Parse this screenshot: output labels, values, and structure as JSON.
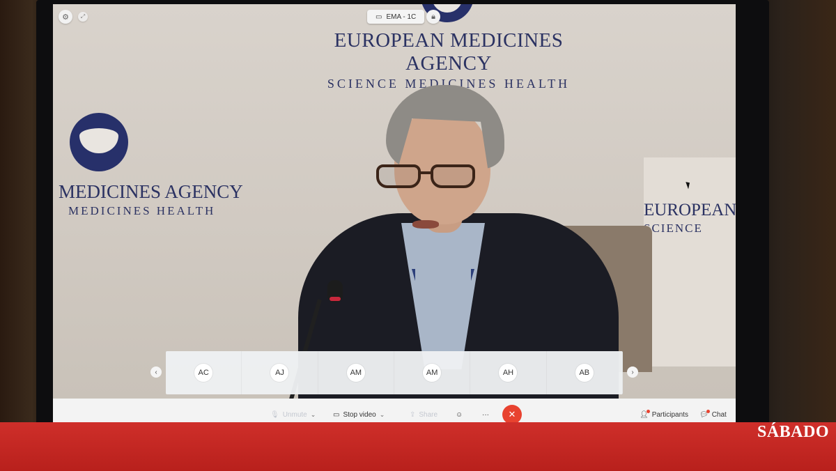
{
  "meeting": {
    "title": "EMA - 1C"
  },
  "backdrop": {
    "org_name": "EUROPEAN MEDICINES AGENCY",
    "tagline": "SCIENCE  MEDICINES  HEALTH",
    "left_name": "MEDICINES AGENCY",
    "left_tagline": "MEDICINES  HEALTH",
    "right_name": "EUROPEAN",
    "right_tagline": "SCIENCE"
  },
  "participants": [
    {
      "initials": "AC"
    },
    {
      "initials": "AJ"
    },
    {
      "initials": "AM"
    },
    {
      "initials": "AM"
    },
    {
      "initials": "AH"
    },
    {
      "initials": "AB"
    }
  ],
  "toolbar": {
    "unmute_label": "Unmute",
    "stop_video_label": "Stop video",
    "share_label": "Share",
    "participants_label": "Participants",
    "chat_label": "Chat"
  },
  "icons": {
    "mic": "microphone-icon",
    "video": "video-camera-icon",
    "share": "share-screen-icon",
    "emoji": "emoji-icon",
    "more": "ellipsis-icon",
    "end": "close-icon"
  },
  "colors": {
    "end_call": "#e8422f",
    "banner": "#c3261f",
    "brand_text": "#ffffff"
  },
  "banner": {
    "brand": "SÁBADO"
  }
}
